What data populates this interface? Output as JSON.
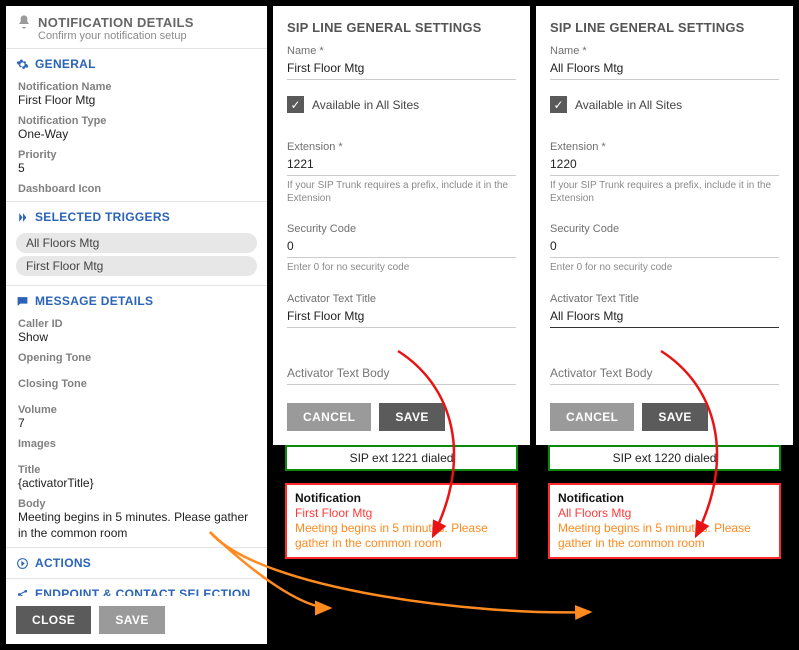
{
  "left": {
    "header_title": "NOTIFICATION DETAILS",
    "header_sub": "Confirm your notification setup",
    "section_general": "GENERAL",
    "name_lbl": "Notification Name",
    "name_val": "First Floor Mtg",
    "type_lbl": "Notification Type",
    "type_val": "One-Way",
    "priority_lbl": "Priority",
    "priority_val": "5",
    "dashicon_lbl": "Dashboard Icon",
    "section_triggers": "SELECTED TRIGGERS",
    "trigger1": "All Floors Mtg",
    "trigger2": "First Floor Mtg",
    "section_message": "MESSAGE DETAILS",
    "caller_lbl": "Caller ID",
    "caller_val": "Show",
    "opening_lbl": "Opening Tone",
    "closing_lbl": "Closing Tone",
    "volume_lbl": "Volume",
    "volume_val": "7",
    "images_lbl": "Images",
    "title_lbl": "Title",
    "title_val": "{activatorTitle}",
    "body_lbl": "Body",
    "body_val": "Meeting begins in 5 minutes. Please gather in the common room",
    "section_actions": "ACTIONS",
    "section_endpoint": "ENDPOINT & CONTACT SELECTION",
    "btn_close": "CLOSE",
    "btn_save": "SAVE"
  },
  "sip1": {
    "heading": "SIP LINE GENERAL SETTINGS",
    "name_lbl": "Name *",
    "name_val": "First Floor Mtg",
    "avail_lbl": "Available in All Sites",
    "ext_lbl": "Extension *",
    "ext_val": "1221",
    "ext_help": "If your SIP Trunk requires a prefix, include it in the Extension",
    "sec_lbl": "Security Code",
    "sec_val": "0",
    "sec_help": "Enter 0 for no security code",
    "act_title_lbl": "Activator Text Title",
    "act_title_val": "First Floor Mtg",
    "act_body_ph": "Activator Text Body",
    "btn_cancel": "CANCEL",
    "btn_save": "SAVE",
    "ext_box": "SIP ext 1221 dialed",
    "notif_h": "Notification",
    "notif_a": "First Floor Mtg",
    "notif_b": "Meeting begins in 5 minutes. Please gather in the common room"
  },
  "sip2": {
    "heading": "SIP LINE GENERAL SETTINGS",
    "name_lbl": "Name *",
    "name_val": "All Floors Mtg",
    "avail_lbl": "Available in All Sites",
    "ext_lbl": "Extension *",
    "ext_val": "1220",
    "ext_help": "If your SIP Trunk requires a prefix, include it in the Extension",
    "sec_lbl": "Security Code",
    "sec_val": "0",
    "sec_help": "Enter 0 for no security code",
    "act_title_lbl": "Activator Text Title",
    "act_title_val": "All Floors Mtg",
    "act_body_ph": "Activator Text Body",
    "btn_cancel": "CANCEL",
    "btn_save": "SAVE",
    "ext_box": "SIP ext 1220 dialed",
    "notif_h": "Notification",
    "notif_a": "All Floors Mtg",
    "notif_b": "Meeting begins in 5 minutes. Please gather in the common room"
  }
}
